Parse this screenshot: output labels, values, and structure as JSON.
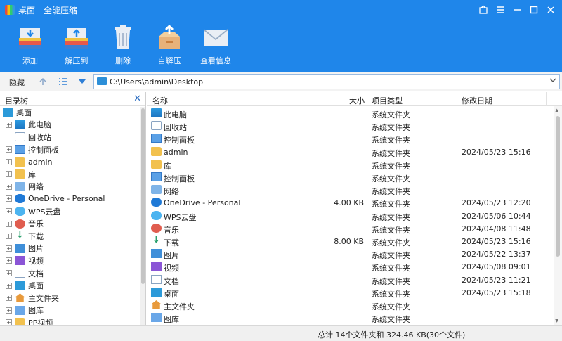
{
  "window": {
    "title": "桌面 - 全能压缩"
  },
  "toolbar": {
    "add": "添加",
    "extract_to": "解压到",
    "delete": "删除",
    "self_extract": "自解压",
    "info": "查看信息"
  },
  "addressbar": {
    "hide": "隐藏",
    "path": "C:\\Users\\admin\\Desktop"
  },
  "tree": {
    "title": "目录树",
    "items": [
      {
        "label": "桌面",
        "icon": "desktop-icon"
      },
      {
        "label": "此电脑",
        "icon": "computer-icon"
      },
      {
        "label": "回收站",
        "icon": "recycle-bin-icon"
      },
      {
        "label": "控制面板",
        "icon": "control-panel-icon"
      },
      {
        "label": "admin",
        "icon": "folder-icon"
      },
      {
        "label": "库",
        "icon": "folder-icon"
      },
      {
        "label": "网络",
        "icon": "network-icon"
      },
      {
        "label": "OneDrive - Personal",
        "icon": "cloud-icon"
      },
      {
        "label": "WPS云盘",
        "icon": "wps-cloud-icon"
      },
      {
        "label": "音乐",
        "icon": "music-icon"
      },
      {
        "label": "下载",
        "icon": "download-icon"
      },
      {
        "label": "图片",
        "icon": "pictures-icon"
      },
      {
        "label": "视频",
        "icon": "videos-icon"
      },
      {
        "label": "文档",
        "icon": "documents-icon"
      },
      {
        "label": "桌面",
        "icon": "desktop-icon"
      },
      {
        "label": "主文件夹",
        "icon": "home-icon"
      },
      {
        "label": "图库",
        "icon": "gallery-icon"
      },
      {
        "label": "PP视频",
        "icon": "folder-icon"
      }
    ]
  },
  "files": {
    "columns": {
      "name": "名称",
      "size": "大小",
      "type": "项目类型",
      "modified": "修改日期"
    },
    "rows": [
      {
        "name": "此电脑",
        "size": "",
        "type": "系统文件夹",
        "modified": "",
        "icon": "computer-icon"
      },
      {
        "name": "回收站",
        "size": "",
        "type": "系统文件夹",
        "modified": "",
        "icon": "recycle-bin-icon"
      },
      {
        "name": "控制面板",
        "size": "",
        "type": "系统文件夹",
        "modified": "",
        "icon": "control-panel-icon"
      },
      {
        "name": "admin",
        "size": "",
        "type": "系统文件夹",
        "modified": "2024/05/23   15:16",
        "icon": "folder-icon"
      },
      {
        "name": "库",
        "size": "",
        "type": "系统文件夹",
        "modified": "",
        "icon": "folder-icon"
      },
      {
        "name": "控制面板",
        "size": "",
        "type": "系统文件夹",
        "modified": "",
        "icon": "control-panel-icon"
      },
      {
        "name": "网络",
        "size": "",
        "type": "系统文件夹",
        "modified": "",
        "icon": "network-icon"
      },
      {
        "name": "OneDrive - Personal",
        "size": "4.00 KB",
        "type": "系统文件夹",
        "modified": "2024/05/23   12:20",
        "icon": "cloud-icon"
      },
      {
        "name": "WPS云盘",
        "size": "",
        "type": "系统文件夹",
        "modified": "2024/05/06   10:44",
        "icon": "wps-cloud-icon"
      },
      {
        "name": "音乐",
        "size": "",
        "type": "系统文件夹",
        "modified": "2024/04/08   11:48",
        "icon": "music-icon"
      },
      {
        "name": "下载",
        "size": "8.00 KB",
        "type": "系统文件夹",
        "modified": "2024/05/23   15:16",
        "icon": "download-icon"
      },
      {
        "name": "图片",
        "size": "",
        "type": "系统文件夹",
        "modified": "2024/05/22   13:37",
        "icon": "pictures-icon"
      },
      {
        "name": "视频",
        "size": "",
        "type": "系统文件夹",
        "modified": "2024/05/08   09:01",
        "icon": "videos-icon"
      },
      {
        "name": "文档",
        "size": "",
        "type": "系统文件夹",
        "modified": "2024/05/23   11:21",
        "icon": "documents-icon"
      },
      {
        "name": "桌面",
        "size": "",
        "type": "系统文件夹",
        "modified": "2024/05/23   15:18",
        "icon": "desktop-icon"
      },
      {
        "name": "主文件夹",
        "size": "",
        "type": "系统文件夹",
        "modified": "",
        "icon": "home-icon"
      },
      {
        "name": "图库",
        "size": "",
        "type": "系统文件夹",
        "modified": "",
        "icon": "gallery-icon"
      }
    ]
  },
  "status": {
    "summary": "总计 14个文件夹和 324.46 KB(30个文件)"
  }
}
